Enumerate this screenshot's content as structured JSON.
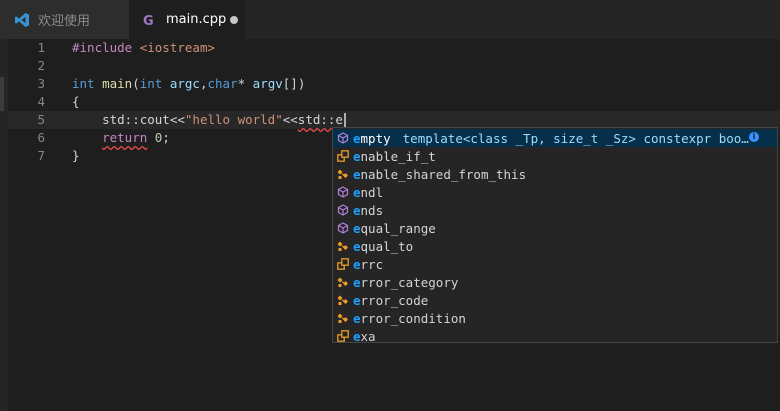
{
  "tabs": [
    {
      "label": "欢迎使用",
      "icon": "vscode-logo-icon",
      "active": false
    },
    {
      "label": "main.cpp",
      "icon": "cpp-file-icon",
      "active": true,
      "dirty": true
    }
  ],
  "editor": {
    "lines": [
      {
        "number": "1",
        "tokens": [
          {
            "text": "#include ",
            "kind": "pre"
          },
          {
            "text": "<iostream>",
            "kind": "inc"
          }
        ]
      },
      {
        "number": "2",
        "tokens": []
      },
      {
        "number": "3",
        "tokens": [
          {
            "text": "int",
            "kind": "ty"
          },
          {
            "text": " ",
            "kind": "pl"
          },
          {
            "text": "main",
            "kind": "fn"
          },
          {
            "text": "(",
            "kind": "pl"
          },
          {
            "text": "int",
            "kind": "ty"
          },
          {
            "text": " ",
            "kind": "pl"
          },
          {
            "text": "argc",
            "kind": "pm"
          },
          {
            "text": ",",
            "kind": "pl"
          },
          {
            "text": "char",
            "kind": "ty"
          },
          {
            "text": "* ",
            "kind": "pl"
          },
          {
            "text": "argv",
            "kind": "pm"
          },
          {
            "text": "[])",
            "kind": "pl"
          }
        ]
      },
      {
        "number": "4",
        "tokens": [
          {
            "text": "{",
            "kind": "pl"
          }
        ]
      },
      {
        "number": "5",
        "current": true,
        "tokens": [
          {
            "text": "    std::cout<<",
            "kind": "pl"
          },
          {
            "text": "\"hello world\"",
            "kind": "str"
          },
          {
            "text": "<<",
            "kind": "pl"
          },
          {
            "text": "std::e",
            "kind": "pl",
            "squiggle": true
          }
        ]
      },
      {
        "number": "6",
        "tokens": [
          {
            "text": "    ",
            "kind": "pl"
          },
          {
            "text": "return",
            "kind": "pre",
            "squiggle": true
          },
          {
            "text": " ",
            "kind": "pl"
          },
          {
            "text": "0",
            "kind": "num"
          },
          {
            "text": ";",
            "kind": "pl"
          }
        ]
      },
      {
        "number": "7",
        "tokens": [
          {
            "text": "}",
            "kind": "pl"
          }
        ]
      }
    ]
  },
  "suggestions": {
    "typed_prefix": "e",
    "items": [
      {
        "match": "e",
        "rest": "mpty",
        "icon": "cube-icon",
        "kind": "method",
        "selected": true,
        "detail": "template<class _Tp, size_t _Sz> constexpr boo…"
      },
      {
        "match": "e",
        "rest": "nable_if_t",
        "icon": "type-alias-icon",
        "kind": "type"
      },
      {
        "match": "e",
        "rest": "nable_shared_from_this",
        "icon": "class-icon",
        "kind": "class"
      },
      {
        "match": "e",
        "rest": "ndl",
        "icon": "cube-icon",
        "kind": "method"
      },
      {
        "match": "e",
        "rest": "nds",
        "icon": "cube-icon",
        "kind": "method"
      },
      {
        "match": "e",
        "rest": "qual_range",
        "icon": "cube-icon",
        "kind": "method"
      },
      {
        "match": "e",
        "rest": "qual_to",
        "icon": "class-icon",
        "kind": "class"
      },
      {
        "match": "e",
        "rest": "rrc",
        "icon": "type-alias-icon",
        "kind": "type"
      },
      {
        "match": "e",
        "rest": "rror_category",
        "icon": "class-icon",
        "kind": "class"
      },
      {
        "match": "e",
        "rest": "rror_code",
        "icon": "class-icon",
        "kind": "class"
      },
      {
        "match": "e",
        "rest": "rror_condition",
        "icon": "class-icon",
        "kind": "class"
      },
      {
        "match": "e",
        "rest": "xa",
        "icon": "type-alias-icon",
        "kind": "type"
      }
    ],
    "info_icon": "info-icon",
    "info_glyph": "i"
  },
  "colors": {
    "editor_bg": "#1e1e1e",
    "keyword_preprocessor": "#c586c0",
    "type": "#569cd6",
    "function": "#dcdcaa",
    "parameter": "#9cdcfe",
    "string": "#ce9178",
    "number": "#b5cea8",
    "match_highlight": "#18a3ff",
    "selected_bg": "#062f4a",
    "method_icon": "#b180d7",
    "class_icon": "#ee9d28"
  }
}
